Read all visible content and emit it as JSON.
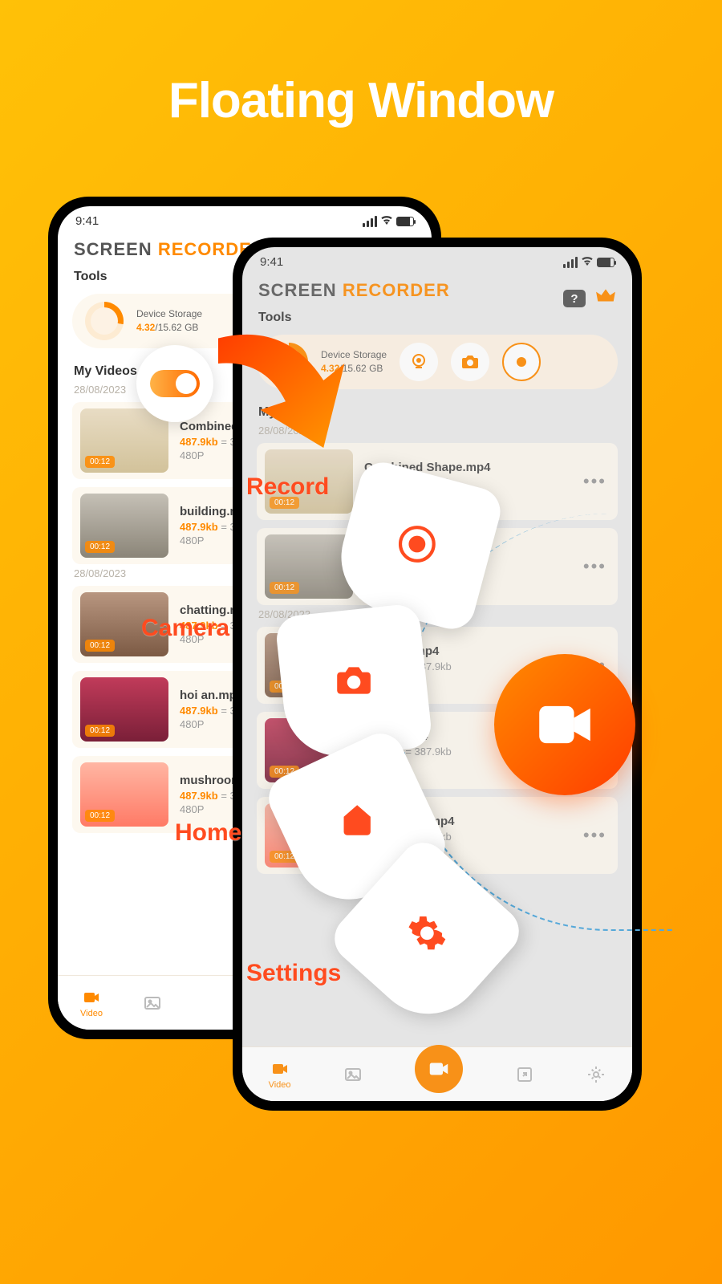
{
  "hero": {
    "title": "Floating Window"
  },
  "statusbar": {
    "time": "9:41"
  },
  "app": {
    "title_a": "SCREEN",
    "title_b": "RECORDER"
  },
  "sections": {
    "tools": "Tools",
    "my_videos": "My Videos"
  },
  "storage": {
    "label": "Device Storage",
    "used": "4.32",
    "sep": "/",
    "total": "15.62 GB"
  },
  "dates": {
    "d1": "28/08/2023",
    "d2": "28/08/2023"
  },
  "duration": "00:12",
  "videos": [
    {
      "name": "Combined Shape.mp4",
      "size": "487.9kb",
      "eq": " = 387.9kb",
      "res": "480P"
    },
    {
      "name": "building.mp4",
      "size": "487.9kb",
      "eq": " = 387.9kb",
      "res": "480P"
    },
    {
      "name": "chatting.mp4",
      "size": "487.9kb",
      "eq": " = 387.9kb",
      "res": "480P"
    },
    {
      "name": "hoi an.mp4",
      "size": "487.9kb",
      "eq": " = 387.9kb",
      "res": "480P"
    },
    {
      "name": "mushroom.mp4",
      "size": "487.9kb",
      "eq": " = 387.9kb",
      "res": "480P"
    }
  ],
  "nav": {
    "video": "Video"
  },
  "float_labels": {
    "record": "Record",
    "camera": "Camera",
    "home": "Home",
    "settings": "Settings"
  },
  "icons": {
    "help": "?",
    "dots": "•••"
  }
}
